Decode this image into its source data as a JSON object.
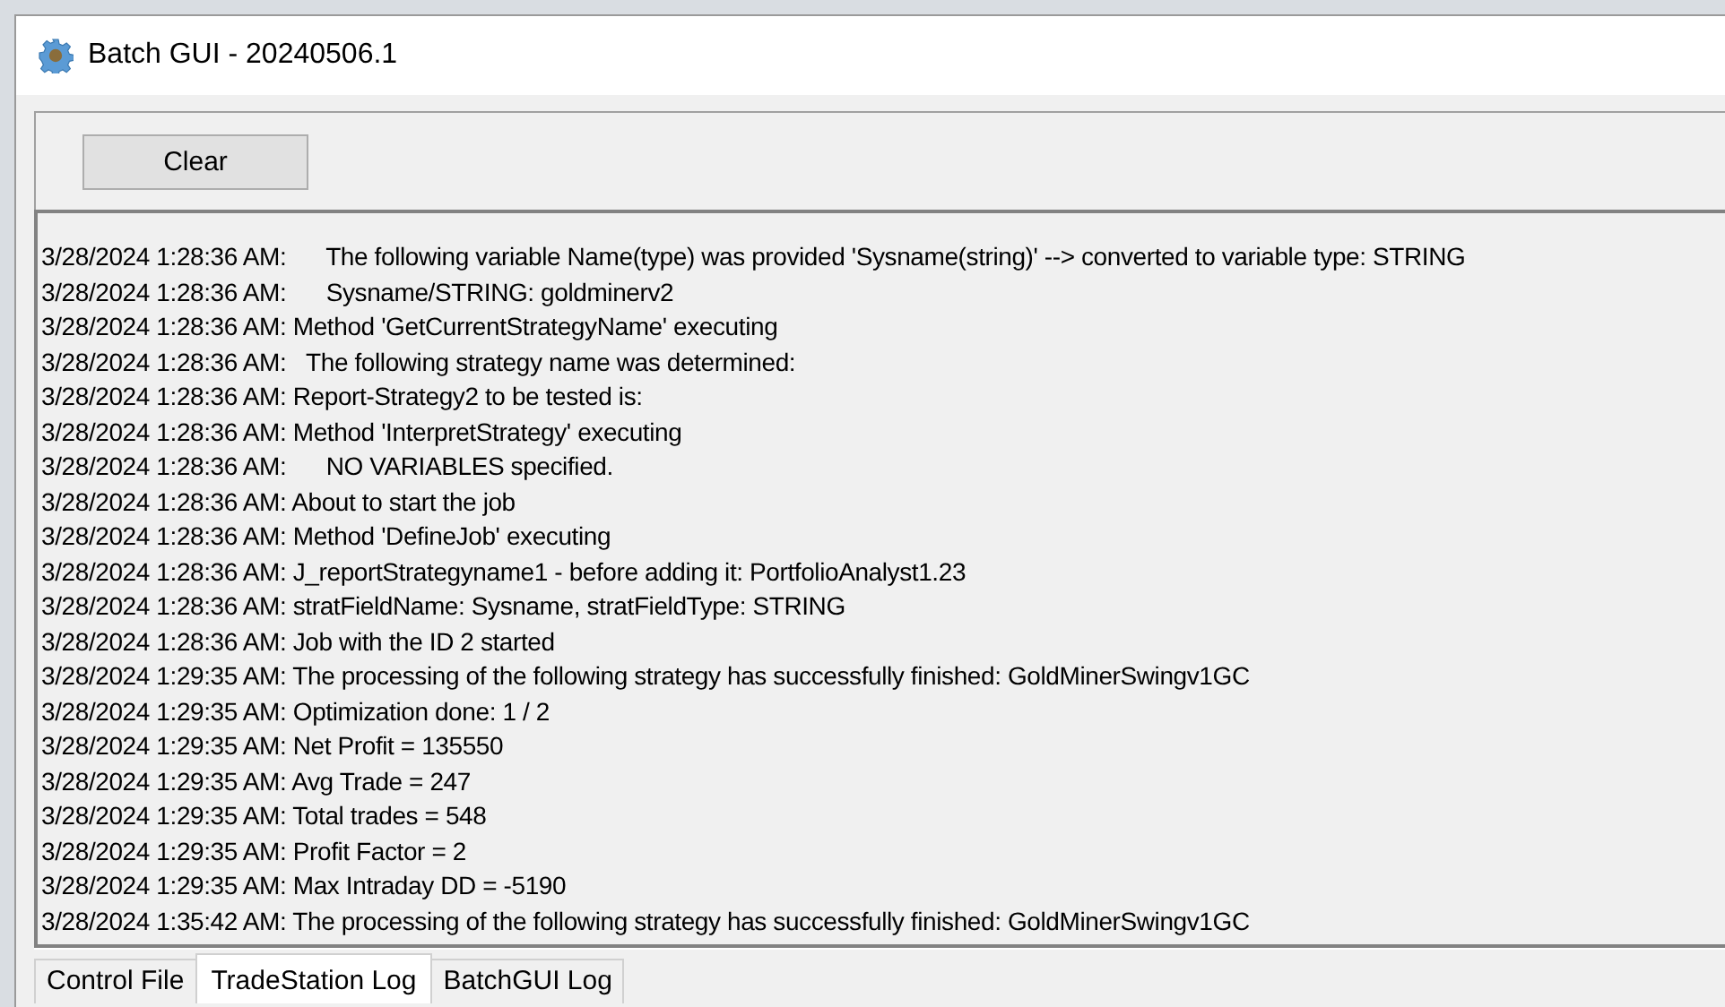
{
  "window": {
    "title": "Batch GUI - 20240506.1"
  },
  "toolbar": {
    "buttons": [
      "Clear"
    ]
  },
  "log": {
    "lines": [
      "3/28/2024 1:28:36 AM:      The following variable Name(type) was provided 'Sysname(string)' --> converted to variable type: STRING",
      "3/28/2024 1:28:36 AM:      Sysname/STRING: goldminerv2",
      "3/28/2024 1:28:36 AM: Method 'GetCurrentStrategyName' executing",
      "3/28/2024 1:28:36 AM:   The following strategy name was determined:",
      "3/28/2024 1:28:36 AM: Report-Strategy2 to be tested is:",
      "3/28/2024 1:28:36 AM: Method 'InterpretStrategy' executing",
      "3/28/2024 1:28:36 AM:      NO VARIABLES specified.",
      "3/28/2024 1:28:36 AM: About to start the job",
      "3/28/2024 1:28:36 AM: Method 'DefineJob' executing",
      "3/28/2024 1:28:36 AM: J_reportStrategyname1 - before adding it: PortfolioAnalyst1.23",
      "3/28/2024 1:28:36 AM: stratFieldName: Sysname, stratFieldType: STRING",
      "3/28/2024 1:28:36 AM: Job with the ID 2 started",
      "3/28/2024 1:29:35 AM: The processing of the following strategy has successfully finished: GoldMinerSwingv1GC",
      "3/28/2024 1:29:35 AM: Optimization done: 1 / 2",
      "3/28/2024 1:29:35 AM: Net Profit = 135550",
      "3/28/2024 1:29:35 AM: Avg Trade = 247",
      "3/28/2024 1:29:35 AM: Total trades = 548",
      "3/28/2024 1:29:35 AM: Profit Factor = 2",
      "3/28/2024 1:29:35 AM: Max Intraday DD = -5190",
      "3/28/2024 1:35:42 AM: The processing of the following strategy has successfully finished: GoldMinerSwingv1GC"
    ]
  },
  "tabs": [
    {
      "label": "Control File",
      "selected": false
    },
    {
      "label": "TradeStation Log",
      "selected": true
    },
    {
      "label": "BatchGUI Log",
      "selected": false
    }
  ]
}
